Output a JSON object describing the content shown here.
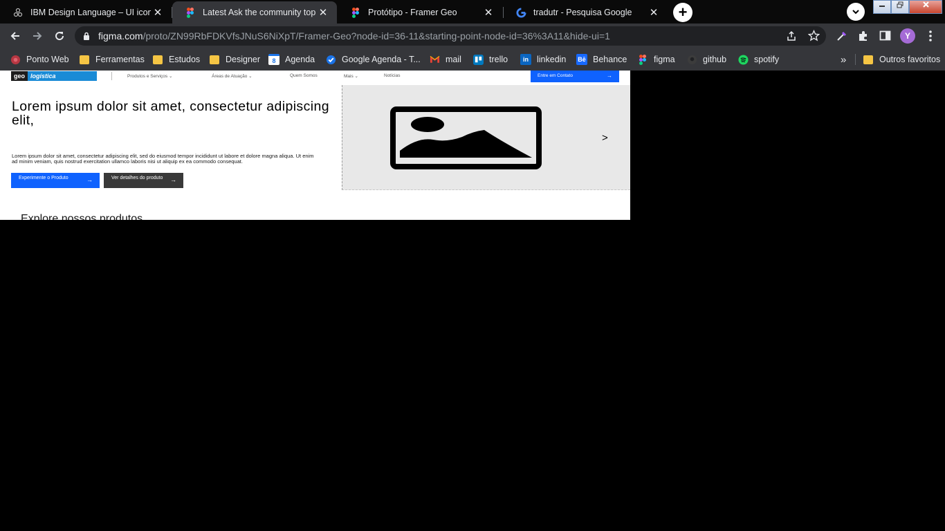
{
  "browser": {
    "tabs": [
      {
        "title": "IBM Design Language – UI icons",
        "icon": "ibm-design-icon"
      },
      {
        "title": "Latest Ask the community topics",
        "icon": "figma-icon"
      },
      {
        "title": "Protótipo - Framer Geo",
        "icon": "figma-icon"
      },
      {
        "title": "tradutr - Pesquisa Google",
        "icon": "google-icon"
      }
    ],
    "active_tab": 1,
    "close_glyph": "✕",
    "new_tab_glyph": "+",
    "url": {
      "host": "figma.com",
      "path": "/proto/ZN99RbFDKVfsJNuS6NiXpT/Framer-Geo?node-id=36-11&starting-point-node-id=36%3A11&hide-ui=1"
    },
    "profile_initial": "Y",
    "bookmarks": [
      {
        "label": "Ponto Web",
        "icon": "ponto-web-icon"
      },
      {
        "label": "Ferramentas",
        "icon": "folder-icon"
      },
      {
        "label": "Estudos",
        "icon": "folder-icon"
      },
      {
        "label": "Designer",
        "icon": "folder-icon"
      },
      {
        "label": "Agenda",
        "icon": "google-calendar-icon",
        "badge": "8"
      },
      {
        "label": "Google Agenda - T...",
        "icon": "google-tasks-icon"
      },
      {
        "label": "mail",
        "icon": "gmail-icon"
      },
      {
        "label": "trello",
        "icon": "trello-icon"
      },
      {
        "label": "linkedin",
        "icon": "linkedin-icon",
        "badge": "in"
      },
      {
        "label": "Behance",
        "icon": "behance-icon",
        "badge": "Bē"
      },
      {
        "label": "figma",
        "icon": "figma-icon"
      },
      {
        "label": "github",
        "icon": "github-icon"
      },
      {
        "label": "spotify",
        "icon": "spotify-icon"
      }
    ],
    "bookmarks_overflow": "»",
    "other_bookmarks": "Outros favoritos"
  },
  "page": {
    "logo": {
      "part1": "geo",
      "part2": "logística"
    },
    "nav": [
      {
        "label": "Produtos e Serviços",
        "chevron": "⌄"
      },
      {
        "label": "Áreas de Atuação",
        "chevron": "⌄"
      },
      {
        "label": "Quem Somos"
      },
      {
        "label": "Mais",
        "chevron": "⌄"
      },
      {
        "label": "Notícias"
      }
    ],
    "cta": {
      "label": "Entre em Contato",
      "arrow": "→"
    },
    "headline": "Lorem ipsum dolor sit amet, consectetur adipiscing elit,",
    "body": "Lorem ipsum dolor sit amet, consectetur adipiscing elit, sed do eiusmod tempor incididunt ut labore et dolore magna aliqua. Ut enim ad minim veniam, quis nostrud exercitation ullamco laboris nisi ut aliquip ex ea commodo consequat.",
    "primary_button": {
      "label": "Experimente o Produto",
      "arrow": "→"
    },
    "secondary_button": {
      "label": "Ver detalhes do produto",
      "arrow": "→"
    },
    "carousel_next": ">",
    "section_title": "Explore nossos produtos"
  }
}
